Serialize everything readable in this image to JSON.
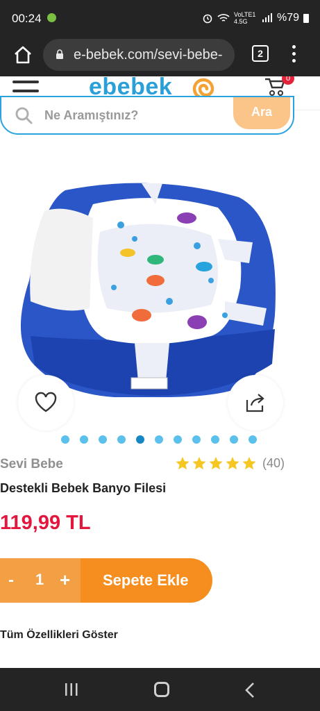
{
  "status_bar": {
    "time": "00:24",
    "network": "VoLTE1 4.5G",
    "battery": "%79"
  },
  "browser": {
    "url": "e-bebek.com/sevi-bebe-",
    "tab_count": "2"
  },
  "site": {
    "logo_text": "ebebek",
    "cart_badge": "0",
    "search_placeholder": "Ne Aramıştınız?",
    "search_button": "Ara"
  },
  "product": {
    "brand": "Sevi Bebe",
    "rating": 5,
    "rating_count": "(40)",
    "name": "Destekli Bebek Banyo Filesi",
    "price": "119,99 TL",
    "image_dots": 11,
    "active_dot": 5,
    "quantity": "1",
    "minus_label": "-",
    "plus_label": "+",
    "add_to_cart": "Sepete Ekle",
    "all_features": "Tüm Özellikleri Göster"
  },
  "colors": {
    "accent_blue": "#29a3dd",
    "price_red": "#e3163d",
    "cta_orange": "#f58e1e",
    "star_yellow": "#f6c623"
  }
}
